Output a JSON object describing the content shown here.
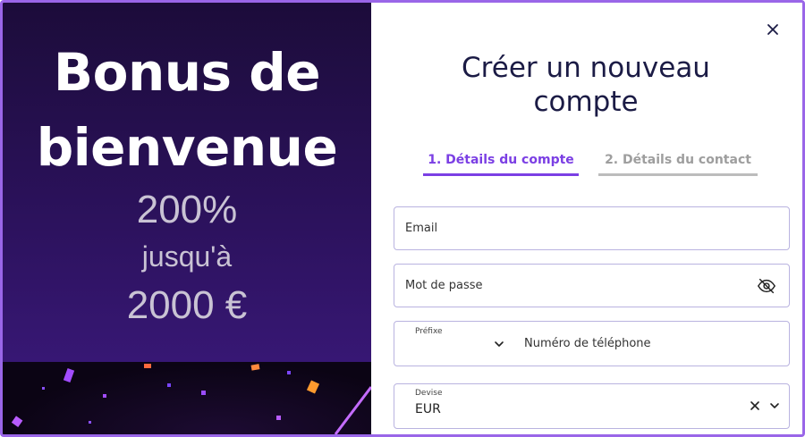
{
  "promo": {
    "title_line1": "Bonus de",
    "title_line2": "bienvenue",
    "percent": "200%",
    "upto": "jusqu'à",
    "amount": "2000 €"
  },
  "form": {
    "title": "Créer un nouveau compte",
    "close_icon": "close-icon",
    "tabs": [
      {
        "label": "1. Détails du compte",
        "active": true
      },
      {
        "label": "2. Détails du contact",
        "active": false
      }
    ],
    "email": {
      "placeholder": "Email"
    },
    "password": {
      "placeholder": "Mot de passe",
      "icon": "eye-off-icon"
    },
    "phone": {
      "prefix_label": "Préfixe",
      "placeholder": "Numéro de téléphone"
    },
    "currency": {
      "label": "Devise",
      "value": "EUR"
    }
  },
  "colors": {
    "accent": "#7b3fe4",
    "border": "#9a66e8",
    "title": "#1b1b45",
    "inactive_tab": "#9e9e9e"
  }
}
